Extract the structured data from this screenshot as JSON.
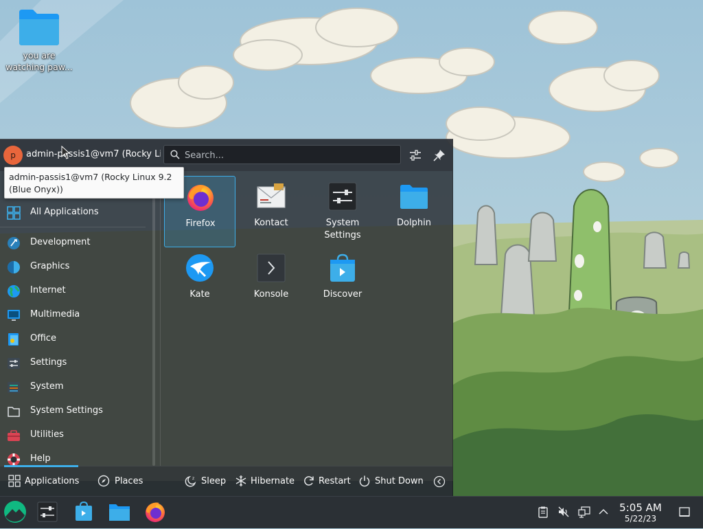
{
  "desktop": {
    "icons": [
      {
        "label": "you are watching paw...",
        "icon": "folder-icon"
      }
    ]
  },
  "launcher": {
    "user": {
      "avatar_letter": "p",
      "name": "admin-passis1@vm7 (Rocky Li..."
    },
    "tooltip": "admin-passis1@vm7 (Rocky Linux 9.2 (Blue Onyx))",
    "search": {
      "placeholder": "Search..."
    },
    "header_buttons": [
      "configure-icon",
      "pin-icon"
    ],
    "categories": [
      {
        "label": "All Applications",
        "icon": "grid-icon"
      },
      {
        "label": "Development",
        "icon": "development-icon"
      },
      {
        "label": "Graphics",
        "icon": "graphics-icon"
      },
      {
        "label": "Internet",
        "icon": "internet-icon"
      },
      {
        "label": "Multimedia",
        "icon": "multimedia-icon"
      },
      {
        "label": "Office",
        "icon": "office-icon"
      },
      {
        "label": "Settings",
        "icon": "settings-icon"
      },
      {
        "label": "System",
        "icon": "system-icon"
      },
      {
        "label": "System Settings",
        "icon": "system-settings-icon"
      },
      {
        "label": "Utilities",
        "icon": "utilities-icon"
      },
      {
        "label": "Help",
        "icon": "help-icon"
      }
    ],
    "apps": [
      {
        "name": "Firefox",
        "icon": "firefox-icon",
        "selected": true
      },
      {
        "name": "Kontact",
        "icon": "kontact-icon"
      },
      {
        "name": "System Settings",
        "icon": "system-settings-icon"
      },
      {
        "name": "Dolphin",
        "icon": "dolphin-icon"
      },
      {
        "name": "Kate",
        "icon": "kate-icon"
      },
      {
        "name": "Konsole",
        "icon": "konsole-icon"
      },
      {
        "name": "Discover",
        "icon": "discover-icon"
      }
    ],
    "footer": {
      "tabs": [
        {
          "label": "Applications",
          "icon": "grid-icon",
          "active": true
        },
        {
          "label": "Places",
          "icon": "compass-icon"
        }
      ],
      "power": [
        {
          "label": "Sleep",
          "icon": "sleep-icon"
        },
        {
          "label": "Hibernate",
          "icon": "hibernate-icon"
        },
        {
          "label": "Restart",
          "icon": "restart-icon"
        },
        {
          "label": "Shut Down",
          "icon": "shutdown-icon"
        }
      ],
      "more_icon": "chevron-left-icon"
    }
  },
  "taskbar": {
    "tasks": [
      "rocky-launcher-icon",
      "system-settings-icon",
      "discover-icon",
      "dolphin-icon",
      "firefox-icon"
    ],
    "tray": [
      "clipboard-icon",
      "volume-muted-icon",
      "network-icon",
      "chevron-up-icon"
    ],
    "clock": {
      "time": "5:05 AM",
      "date": "5/22/23"
    },
    "show_desktop_icon": "show-desktop-icon"
  },
  "colors": {
    "accent": "#3daee9",
    "panel": "#2b3035",
    "text": "#fcfcfc"
  }
}
